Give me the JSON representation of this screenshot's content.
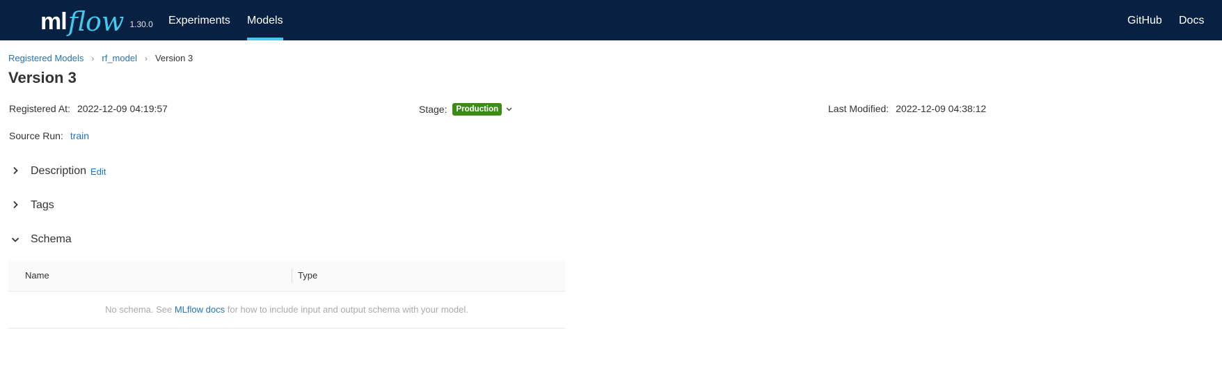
{
  "header": {
    "logo_ml": "ml",
    "logo_flow": "flow",
    "version": "1.30.0",
    "nav": {
      "experiments": "Experiments",
      "models": "Models",
      "github": "GitHub",
      "docs": "Docs"
    },
    "active_nav": "Models"
  },
  "breadcrumb": {
    "registered_models": "Registered Models",
    "model": "rf_model",
    "current": "Version 3",
    "separator": "›"
  },
  "page_title": "Version 3",
  "metadata": {
    "registered_at_label": "Registered At",
    "registered_at_value": "2022-12-09 04:19:57",
    "stage_label": "Stage",
    "stage_value": "Production",
    "stage_color": "#3a8c15",
    "last_modified_label": "Last Modified",
    "last_modified_value": "2022-12-09 04:38:12",
    "source_run_label": "Source Run",
    "source_run_value": "train",
    "colon": ":"
  },
  "sections": {
    "description": "Description",
    "description_edit": "Edit",
    "tags": "Tags",
    "schema": "Schema"
  },
  "schema_table": {
    "col_name": "Name",
    "col_type": "Type",
    "empty_prefix": "No schema. See ",
    "empty_link": "MLflow docs",
    "empty_suffix": " for how to include input and output schema with your model."
  },
  "colors": {
    "topbar": "#082143",
    "accent": "#43c9ed",
    "link": "#2374bb"
  },
  "icons": {
    "breadcrumb_sep": "chevron-right-icon",
    "stage_caret": "chevron-down-icon",
    "collapsed": "chevron-right-icon",
    "expanded": "chevron-down-icon"
  }
}
